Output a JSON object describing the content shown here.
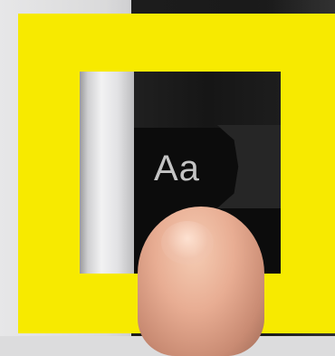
{
  "text_size_control": {
    "label": "Aa"
  },
  "colors": {
    "highlight": "#f7ea00",
    "panel": "#0c0c0c",
    "label": "#c4c4c4"
  }
}
